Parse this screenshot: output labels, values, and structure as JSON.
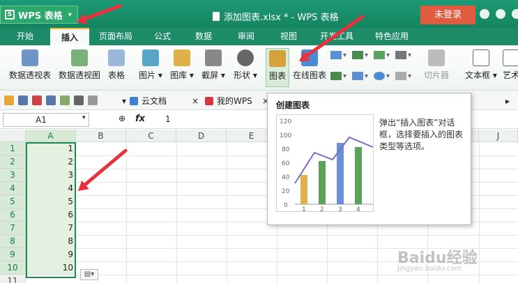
{
  "titlebar": {
    "app_menu_label": "WPS 表格",
    "app_logo": "S",
    "doc_title": "添加图表.xlsx * - WPS 表格",
    "login_label": "未登录"
  },
  "tabs": [
    {
      "label": "开始"
    },
    {
      "label": "插入"
    },
    {
      "label": "页面布局"
    },
    {
      "label": "公式"
    },
    {
      "label": "数据"
    },
    {
      "label": "审阅"
    },
    {
      "label": "视图"
    },
    {
      "label": "开发工具"
    },
    {
      "label": "特色应用"
    }
  ],
  "ribbon": {
    "pivot_table": "数据透视表",
    "pivot_chart": "数据透视图",
    "table": "表格",
    "picture": "图片",
    "gallery": "图库",
    "screenshot": "截屏",
    "shapes": "形状",
    "chart": "图表",
    "online_chart": "在线图表",
    "slicer": "切片器",
    "textbox": "文本框",
    "art": "艺术"
  },
  "doctabs": {
    "cloud_docs": "云文档",
    "my_wps": "我的WPS"
  },
  "formula_bar": {
    "name_box": "A1",
    "fx_label": "fx",
    "value": "1"
  },
  "grid": {
    "columns": [
      "A",
      "B",
      "C",
      "D",
      "E",
      "J"
    ],
    "rows": [
      "1",
      "2",
      "3",
      "4",
      "5",
      "6",
      "7",
      "8",
      "9",
      "10",
      "11"
    ],
    "col_a_values": [
      "1",
      "2",
      "3",
      "4",
      "5",
      "6",
      "7",
      "8",
      "9",
      "10"
    ]
  },
  "tooltip": {
    "title": "创建图表",
    "description": "弹出“插入图表”对话框，选择要插入的图表类型等选项。",
    "chart_yticks": [
      "120",
      "100",
      "80",
      "60",
      "40",
      "20",
      "0"
    ],
    "chart_xticks": [
      "1",
      "2",
      "3",
      "4"
    ]
  },
  "watermark": {
    "main": "Baidu经验",
    "sub": "jingyan.baidu.com"
  },
  "colors": {
    "brand": "#1d8b68",
    "login": "#e05b40",
    "arrow": "#e8323d",
    "selection": "#1f8b4d"
  }
}
